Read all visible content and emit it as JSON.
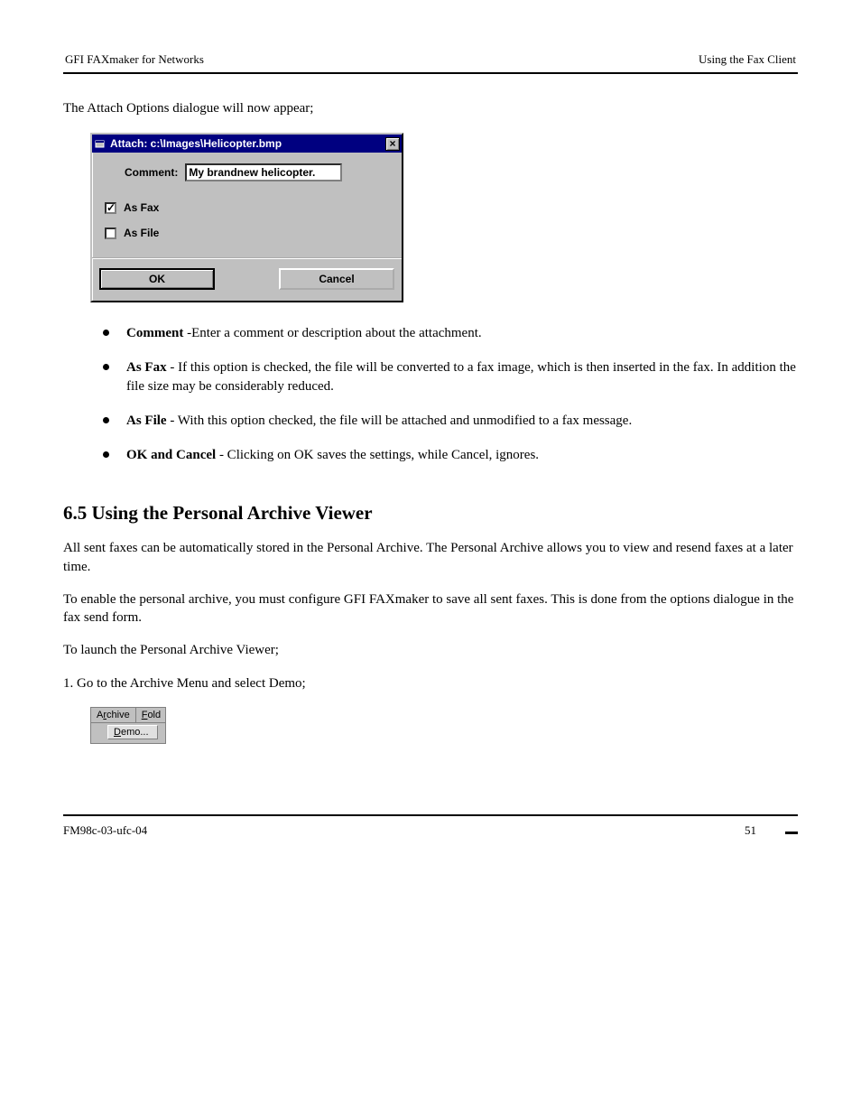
{
  "header": {
    "left": "GFI FAXmaker for Networks",
    "right": "Using the Fax Client"
  },
  "intro": "The Attach Options dialogue will now appear;",
  "dialog": {
    "title": "Attach: c:\\Images\\Helicopter.bmp",
    "comment_label": "Comment:",
    "comment_value": "My brandnew helicopter.",
    "chk_fax": "As Fax",
    "chk_file": "As File",
    "ok": "OK",
    "cancel": "Cancel"
  },
  "bullets": [
    {
      "label": "Comment",
      "text": " -Enter a comment or description about the attachment."
    },
    {
      "label": "As Fax",
      "text": " - If this option is checked, the file will be converted to a fax image, which is then inserted in the fax. In addition the file size may be considerably reduced."
    },
    {
      "label": "As File",
      "text": " - With this option checked, the file will be attached and unmodified to a fax message."
    },
    {
      "label": "OK and Cancel",
      "text": " - Clicking on OK saves the settings, while Cancel, ignores."
    }
  ],
  "section": {
    "number": "6.5",
    "title": "  Using the Personal Archive Viewer",
    "p1": "All sent faxes can be automatically stored in the Personal Archive. The Personal Archive allows you to view and resend faxes at a later time.",
    "p2": "To enable the personal archive, you must configure GFI FAXmaker to save all sent faxes. This is done from the options dialogue in the fax send form.",
    "p3": "To launch the Personal Archive Viewer;",
    "step1": "1.  Go to the Archive Menu and select Demo;"
  },
  "menu": {
    "archive_prefix": "A",
    "archive_u": "r",
    "archive_suffix": "chive",
    "fold_u": "F",
    "fold_suffix": "old",
    "demo_u": "D",
    "demo_suffix": "emo..."
  },
  "footer": {
    "left": "FM98c-03-ufc-04",
    "right": "51"
  }
}
